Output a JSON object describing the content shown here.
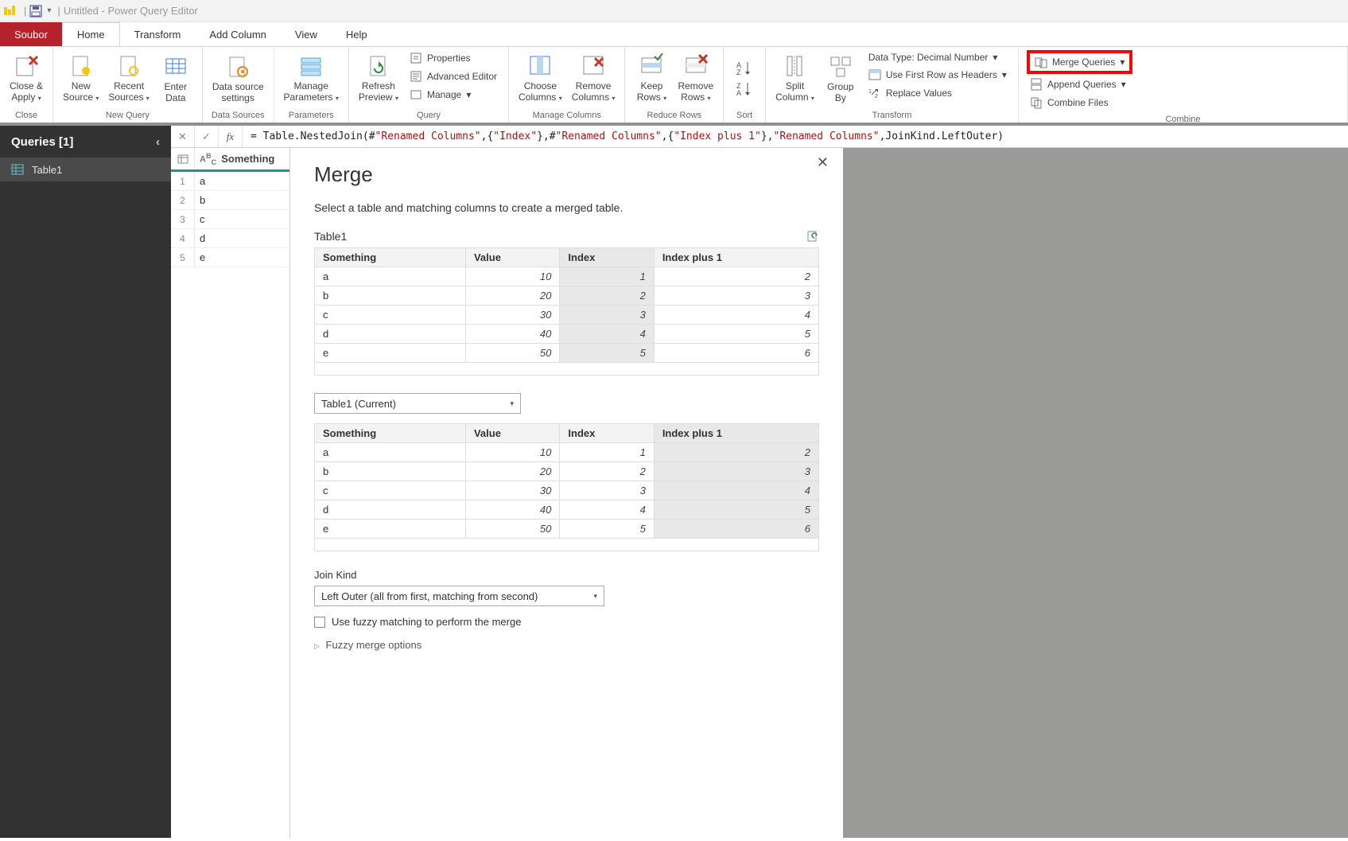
{
  "titlebar": {
    "title": "Untitled - Power Query Editor"
  },
  "tabs": {
    "file": "Soubor",
    "home": "Home",
    "transform": "Transform",
    "addcol": "Add Column",
    "view": "View",
    "help": "Help"
  },
  "ribbon": {
    "close_apply": "Close &\nApply",
    "new_source": "New\nSource",
    "recent_sources": "Recent\nSources",
    "enter_data": "Enter\nData",
    "data_source_settings": "Data source\nsettings",
    "manage_params": "Manage\nParameters",
    "refresh_preview": "Refresh\nPreview",
    "properties": "Properties",
    "advanced_editor": "Advanced Editor",
    "manage": "Manage",
    "choose_columns": "Choose\nColumns",
    "remove_columns": "Remove\nColumns",
    "keep_rows": "Keep\nRows",
    "remove_rows": "Remove\nRows",
    "split_column": "Split\nColumn",
    "group_by": "Group\nBy",
    "data_type": "Data Type: Decimal Number",
    "first_row_headers": "Use First Row as Headers",
    "replace_values": "Replace Values",
    "merge_queries": "Merge Queries",
    "append_queries": "Append Queries",
    "combine_files": "Combine Files",
    "groups": {
      "close": "Close",
      "new_query": "New Query",
      "data_sources": "Data Sources",
      "parameters": "Parameters",
      "query": "Query",
      "manage_columns": "Manage Columns",
      "reduce_rows": "Reduce Rows",
      "sort": "Sort",
      "transform": "Transform",
      "combine": "Combine"
    }
  },
  "sidebar": {
    "title": "Queries [1]",
    "items": [
      {
        "label": "Table1"
      }
    ]
  },
  "formula": {
    "prefix": "= ",
    "fn": "Table.NestedJoin",
    "parts": [
      "#\"Renamed Columns\"",
      "{\"Index\"}",
      "#\"Renamed Columns\"",
      "{\"Index plus 1\"}",
      "\"Renamed Columns\""
    ],
    "join": "JoinKind.LeftOuter"
  },
  "preview": {
    "column": "Something",
    "rows": [
      "a",
      "b",
      "c",
      "d",
      "e"
    ]
  },
  "merge": {
    "title": "Merge",
    "desc": "Select a table and matching columns to create a merged table.",
    "table1_label": "Table1",
    "columns": [
      "Something",
      "Value",
      "Index",
      "Index plus 1"
    ],
    "rows": [
      {
        "something": "a",
        "value": 10,
        "index": 1,
        "indexplus": 2
      },
      {
        "something": "b",
        "value": 20,
        "index": 2,
        "indexplus": 3
      },
      {
        "something": "c",
        "value": 30,
        "index": 3,
        "indexplus": 4
      },
      {
        "something": "d",
        "value": 40,
        "index": 4,
        "indexplus": 5
      },
      {
        "something": "e",
        "value": 50,
        "index": 5,
        "indexplus": 6
      }
    ],
    "t1_selcol": 2,
    "t2_selcol": 3,
    "combo2": "Table1 (Current)",
    "join_kind_label": "Join Kind",
    "join_kind": "Left Outer (all from first, matching from second)",
    "fuzzy_label": "Use fuzzy matching to perform the merge",
    "fuzzy_checked": false,
    "fuzzy_options": "Fuzzy merge options"
  }
}
